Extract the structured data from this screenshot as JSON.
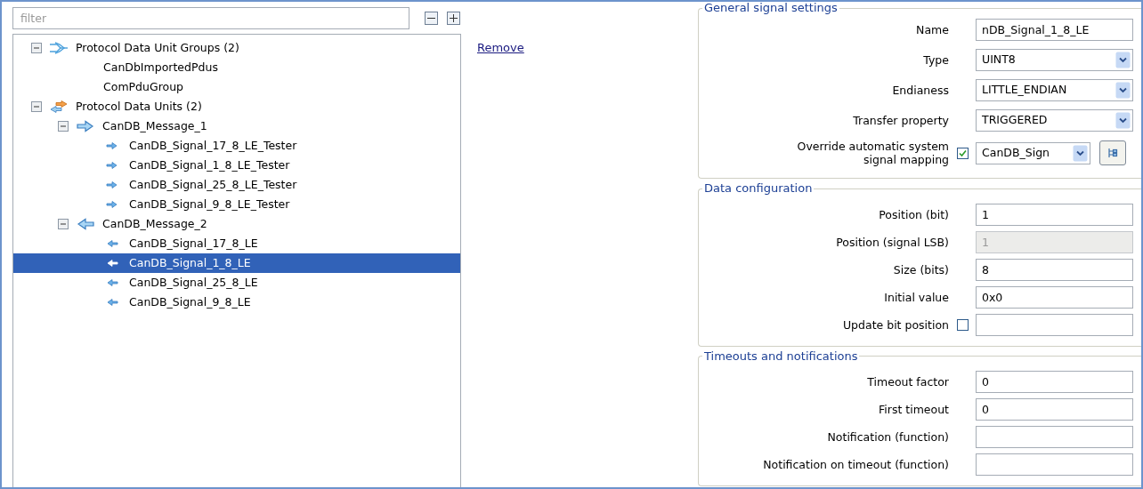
{
  "filter": {
    "placeholder": "filter"
  },
  "tree": [
    {
      "label": "Protocol Data Unit Groups (2)",
      "kind": "group",
      "expanded": true,
      "selected": false,
      "children": [
        {
          "label": "CanDbImportedPdus",
          "kind": "plain",
          "selected": false
        },
        {
          "label": "ComPduGroup",
          "kind": "plain",
          "selected": false
        }
      ]
    },
    {
      "label": "Protocol Data Units (2)",
      "kind": "pdus",
      "expanded": true,
      "selected": false,
      "children": [
        {
          "label": "CanDB_Message_1",
          "kind": "tx-message",
          "expanded": true,
          "selected": false,
          "children": [
            {
              "label": "CanDB_Signal_17_8_LE_Tester",
              "kind": "tx-signal",
              "selected": false
            },
            {
              "label": "CanDB_Signal_1_8_LE_Tester",
              "kind": "tx-signal",
              "selected": false
            },
            {
              "label": "CanDB_Signal_25_8_LE_Tester",
              "kind": "tx-signal",
              "selected": false
            },
            {
              "label": "CanDB_Signal_9_8_LE_Tester",
              "kind": "tx-signal",
              "selected": false
            }
          ]
        },
        {
          "label": "CanDB_Message_2",
          "kind": "rx-message",
          "expanded": true,
          "selected": false,
          "children": [
            {
              "label": "CanDB_Signal_17_8_LE",
              "kind": "rx-signal",
              "selected": false
            },
            {
              "label": "CanDB_Signal_1_8_LE",
              "kind": "rx-signal",
              "selected": true
            },
            {
              "label": "CanDB_Signal_25_8_LE",
              "kind": "rx-signal",
              "selected": false
            },
            {
              "label": "CanDB_Signal_9_8_LE",
              "kind": "rx-signal",
              "selected": false
            }
          ]
        }
      ]
    }
  ],
  "remove_link": "Remove",
  "sections": [
    {
      "title": "General signal settings",
      "rows": [
        {
          "label": "Name",
          "kind": "text",
          "value": "nDB_Signal_1_8_LE",
          "disabled": false
        },
        {
          "label": "Type",
          "kind": "combo",
          "value": "UINT8"
        },
        {
          "label": "Endianess",
          "kind": "combo",
          "value": "LITTLE_ENDIAN"
        },
        {
          "label": "Transfer property",
          "kind": "combo",
          "value": "TRIGGERED"
        },
        {
          "label": "Override automatic system signal mapping",
          "kind": "check-combo",
          "checked": true,
          "value": "CanDB_Sign"
        }
      ]
    },
    {
      "title": "Data configuration",
      "rows": [
        {
          "label": "Position (bit)",
          "kind": "text",
          "value": "1",
          "disabled": false
        },
        {
          "label": "Position (signal LSB)",
          "kind": "text",
          "value": "1",
          "disabled": true
        },
        {
          "label": "Size (bits)",
          "kind": "text",
          "value": "8",
          "disabled": false
        },
        {
          "label": "Initial value",
          "kind": "text",
          "value": "0x0",
          "disabled": false
        },
        {
          "label": "Update bit position",
          "kind": "check-text",
          "checked": false
        }
      ]
    },
    {
      "title": "Timeouts and notifications",
      "rows": [
        {
          "label": "Timeout factor",
          "kind": "text",
          "value": "0",
          "disabled": false
        },
        {
          "label": "First timeout",
          "kind": "text",
          "value": "0",
          "disabled": false
        },
        {
          "label": "Notification (function)",
          "kind": "text",
          "disabled": false
        },
        {
          "label": "Notification on timeout (function)",
          "kind": "text",
          "disabled": false
        }
      ]
    }
  ]
}
